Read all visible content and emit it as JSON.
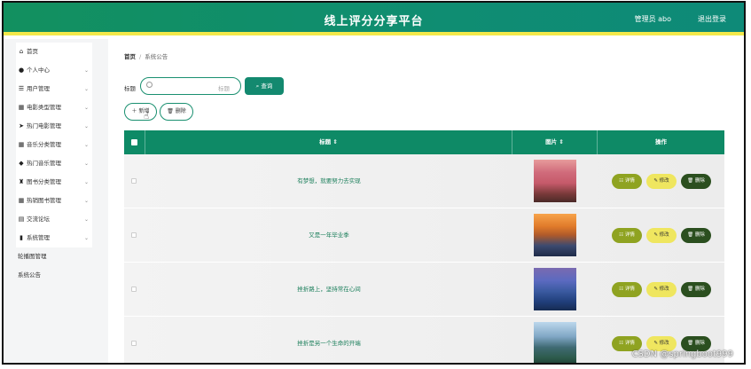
{
  "header": {
    "title": "线上评分分享平台",
    "user": "管理员 abo",
    "logout": "退出登录"
  },
  "sidebar": {
    "items": [
      {
        "label": "首页",
        "icon": "home-icon",
        "glyph": "⌂",
        "chevron": false
      },
      {
        "label": "个人中心",
        "icon": "user-icon",
        "glyph": "●",
        "chevron": true
      },
      {
        "label": "用户管理",
        "icon": "sliders-icon",
        "glyph": "☰",
        "chevron": true
      },
      {
        "label": "电影类型管理",
        "icon": "grid-icon",
        "glyph": "▦",
        "chevron": true
      },
      {
        "label": "热门电影管理",
        "icon": "send-icon",
        "glyph": "➤",
        "chevron": true
      },
      {
        "label": "音乐分类管理",
        "icon": "grid-icon",
        "glyph": "▦",
        "chevron": true
      },
      {
        "label": "热门音乐管理",
        "icon": "location-icon",
        "glyph": "◆",
        "chevron": true
      },
      {
        "label": "图书分类管理",
        "icon": "trophy-icon",
        "glyph": "♜",
        "chevron": true
      },
      {
        "label": "热销图书管理",
        "icon": "grid-icon",
        "glyph": "▦",
        "chevron": true
      },
      {
        "label": "交流论坛",
        "icon": "database-icon",
        "glyph": "▤",
        "chevron": true
      },
      {
        "label": "系统管理",
        "icon": "bar-chart-icon",
        "glyph": "▮",
        "chevron": true
      }
    ],
    "submenu": [
      "轮播图管理",
      "系统公告"
    ]
  },
  "breadcrumb": {
    "home": "首页",
    "separator": "/",
    "current": "系统公告"
  },
  "search": {
    "label": "标题",
    "placeholder": "标题",
    "button": "查询"
  },
  "actions": {
    "add": "新增",
    "delete": "删除"
  },
  "table": {
    "headers": {
      "title": "标题 ⇕",
      "image": "图片 ⇕",
      "ops": "操作"
    },
    "rows": [
      {
        "title": "有梦想，就要努力去实现"
      },
      {
        "title": "又是一年毕业季"
      },
      {
        "title": "挫折路上，坚持常在心间"
      },
      {
        "title": "挫折是另一个生命的开端"
      }
    ],
    "ops": {
      "detail": "详情",
      "edit": "修改",
      "delete": "删除"
    }
  },
  "watermark": "CSDN @springboot999",
  "colors": {
    "primary": "#13896f",
    "accent_bar": "#f3e84a",
    "detail": "#8fa321",
    "edit": "#efe65f",
    "delete": "#2b4f1f"
  }
}
